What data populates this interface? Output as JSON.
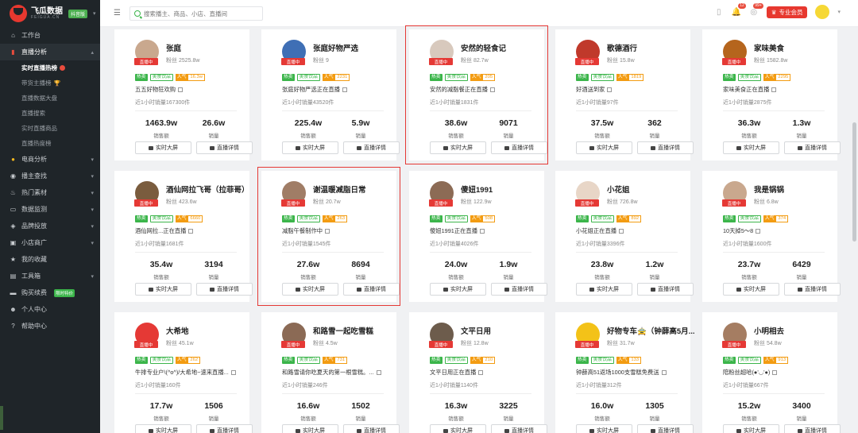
{
  "app": {
    "name": "飞瓜数据",
    "sub": "FEIGUA.CN",
    "edition": "抖音版"
  },
  "sidebar": {
    "items": [
      {
        "label": "工作台",
        "icon": "home-icon"
      },
      {
        "label": "直播分析",
        "icon": "bar-chart-icon",
        "expanded": true
      },
      {
        "label": "电商分析",
        "icon": "bag-icon"
      },
      {
        "label": "播主查找",
        "icon": "search-icon"
      },
      {
        "label": "热门素材",
        "icon": "fire-icon"
      },
      {
        "label": "数据监测",
        "icon": "monitor-icon"
      },
      {
        "label": "品牌投放",
        "icon": "brand-icon"
      },
      {
        "label": "小店商广",
        "icon": "shop-icon"
      },
      {
        "label": "我的收藏",
        "icon": "star-icon"
      },
      {
        "label": "工具箱",
        "icon": "toolbox-icon"
      },
      {
        "label": "购买续费",
        "icon": "card-icon",
        "badge": "限时特价"
      },
      {
        "label": "个人中心",
        "icon": "user-icon"
      },
      {
        "label": "帮助中心",
        "icon": "help-icon"
      }
    ],
    "sub_items": [
      {
        "label": "实时直播热榜",
        "current": true
      },
      {
        "label": "带货主播榜"
      },
      {
        "label": "直播数据大盘"
      },
      {
        "label": "直播搜索"
      },
      {
        "label": "实时直播商品"
      },
      {
        "label": "直播热度榜"
      }
    ]
  },
  "topbar": {
    "search_placeholder": "搜索播主、商品、小店、直播间",
    "bell_count": "12",
    "msg_count": "99+",
    "vip_label": "专业会员"
  },
  "common": {
    "live_tag": "直播中",
    "hot_tag": "热卖",
    "popularity_label": "人气",
    "fans_prefix": "粉丝",
    "sales_amount_label": "销售额",
    "sales_count_label": "销量",
    "realtime_button": "实时大屏",
    "detail_button": "直播详情"
  },
  "cards": [
    {
      "name": "张庭",
      "fans": "粉丝 2525.8w",
      "category": "美食饮品",
      "popularity": "16.3w",
      "title": "五五好物狂欢购",
      "recent": "近1小时销量167300件",
      "sales_amount": "1463.9w",
      "sales_count": "26.6w",
      "highlight": false,
      "avatar_color": "#c9a88e"
    },
    {
      "name": "张庭好物严选",
      "fans": "粉丝 9",
      "category": "美食饮品",
      "popularity": "2231",
      "title": "张庭好物严选正在直播",
      "recent": "近1小时销量43520件",
      "sales_amount": "225.4w",
      "sales_count": "5.9w",
      "highlight": false,
      "avatar_color": "#3f6fb5"
    },
    {
      "name": "安然的轻食记",
      "fans": "粉丝 82.7w",
      "category": "美食饮品",
      "popularity": "205",
      "title": "安然的减脂餐正在直播",
      "recent": "近1小时销量1831件",
      "sales_amount": "38.6w",
      "sales_count": "9071",
      "highlight": true,
      "avatar_color": "#d8c9bd"
    },
    {
      "name": "歌德酒行",
      "fans": "粉丝 15.8w",
      "category": "美食饮品",
      "popularity": "1819",
      "title": "好酒送到家",
      "recent": "近1小时销量97件",
      "sales_amount": "37.5w",
      "sales_count": "362",
      "highlight": false,
      "avatar_color": "#c0392b"
    },
    {
      "name": "家味美食",
      "fans": "粉丝 1582.8w",
      "category": "美食饮品",
      "popularity": "2295",
      "title": "家味美食正在直播",
      "recent": "近1小时销量2875件",
      "sales_amount": "36.3w",
      "sales_count": "1.3w",
      "highlight": false,
      "avatar_color": "#b5651d"
    },
    {
      "name": "酒仙网拉飞哥（拉菲哥）",
      "fans": "粉丝 423.6w",
      "category": "美食饮品",
      "popularity": "6660",
      "title": "酒仙网拉...正在直播",
      "recent": "近1小时销量1681件",
      "sales_amount": "35.4w",
      "sales_count": "3194",
      "highlight": false,
      "avatar_color": "#7a5c3e"
    },
    {
      "name": "谢温暖减脂日常",
      "fans": "粉丝 20.7w",
      "category": "美食饮品",
      "popularity": "263",
      "title": "减脂午餐制作中",
      "recent": "近1小时销量1545件",
      "sales_amount": "27.6w",
      "sales_count": "8694",
      "highlight": true,
      "avatar_color": "#a07d66"
    },
    {
      "name": "傻妞1991",
      "fans": "粉丝 122.9w",
      "category": "美食饮品",
      "popularity": "508",
      "title": "傻妞1991正在直播",
      "recent": "近1小时销量4026件",
      "sales_amount": "24.0w",
      "sales_count": "1.9w",
      "highlight": false,
      "avatar_color": "#8c6b55"
    },
    {
      "name": "小花姐",
      "fans": "粉丝 726.8w",
      "category": "美食饮品",
      "popularity": "892",
      "title": "小花姐正在直播",
      "recent": "近1小时销量3396件",
      "sales_amount": "23.8w",
      "sales_count": "1.2w",
      "highlight": false,
      "avatar_color": "#e8d6c7"
    },
    {
      "name": "我是锅锅",
      "fans": "粉丝 6.8w",
      "category": "美食饮品",
      "popularity": "374",
      "title": "10天掉5～8",
      "recent": "近1小时销量1600件",
      "sales_amount": "23.7w",
      "sales_count": "6429",
      "highlight": false,
      "avatar_color": "#c9a88e"
    },
    {
      "name": "大希地",
      "fans": "粉丝 45.1w",
      "category": "美食饮品",
      "popularity": "262",
      "title": "牛排专业户\\(^o^)/大希地~速来直播...",
      "recent": "近1小时销量160件",
      "sales_amount": "17.7w",
      "sales_count": "1506",
      "highlight": false,
      "avatar_color": "#e53935"
    },
    {
      "name": "和路雪一起吃雪糕",
      "fans": "粉丝 4.5w",
      "category": "美食饮品",
      "popularity": "731",
      "title": "和路雪请你吃夏天的第一根雪糕。...",
      "recent": "近1小时销量246件",
      "sales_amount": "16.6w",
      "sales_count": "1502",
      "highlight": false,
      "avatar_color": "#8b6a55"
    },
    {
      "name": "文平日用",
      "fans": "粉丝 12.8w",
      "category": "美食饮品",
      "popularity": "210",
      "title": "文平日用正在直播",
      "recent": "近1小时销量1140件",
      "sales_amount": "16.3w",
      "sales_count": "3225",
      "highlight": false,
      "avatar_color": "#6d5c4c"
    },
    {
      "name": "好物专车🚖（钟薛高5月...",
      "fans": "粉丝 31.7w",
      "category": "美食饮品",
      "popularity": "133",
      "title": "钟薛高51返场1000支雪糕免费送",
      "recent": "近1小时销量312件",
      "sales_amount": "16.0w",
      "sales_count": "1305",
      "highlight": false,
      "avatar_color": "#f3c218"
    },
    {
      "name": "小明相去",
      "fans": "粉丝 54.8w",
      "category": "美食饮品",
      "popularity": "913",
      "title": "陪粉丝超哈(●'◡'●)",
      "recent": "近1小时销量667件",
      "sales_amount": "15.2w",
      "sales_count": "3400",
      "highlight": false,
      "avatar_color": "#a57d62"
    }
  ]
}
